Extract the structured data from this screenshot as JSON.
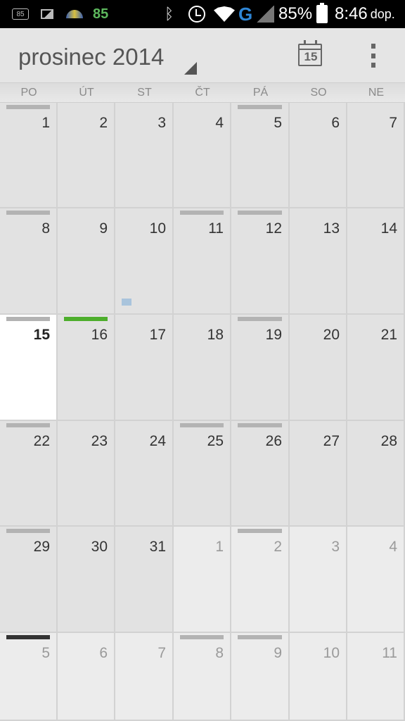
{
  "status_bar": {
    "notification_badge": "85",
    "temperature": "85",
    "network_type": "G",
    "battery": "85%",
    "time": "8:46",
    "time_suffix": "dop.",
    "icons": [
      "notification-85-icon",
      "image-icon",
      "weather-dome-icon",
      "bluetooth-icon",
      "alarm-icon",
      "wifi-icon",
      "cell-signal-icon",
      "battery-icon"
    ]
  },
  "header": {
    "title": "prosinec 2014",
    "today_icon_number": "15",
    "menu_icon": "overflow-menu-icon"
  },
  "weekdays": [
    "PO",
    "ÚT",
    "ST",
    "ČT",
    "PÁ",
    "SO",
    "NE"
  ],
  "colors": {
    "event_bar": "#b3b3b3",
    "event_bar_green": "#4dae2c",
    "event_bar_dark": "#333333",
    "event_block": "#a9c4dc",
    "today_bg": "#ffffff"
  },
  "weeks": [
    [
      {
        "day": "1",
        "bar": "gray"
      },
      {
        "day": "2"
      },
      {
        "day": "3"
      },
      {
        "day": "4"
      },
      {
        "day": "5",
        "bar": "gray"
      },
      {
        "day": "6"
      },
      {
        "day": "7"
      }
    ],
    [
      {
        "day": "8",
        "bar": "gray"
      },
      {
        "day": "9"
      },
      {
        "day": "10",
        "event": true
      },
      {
        "day": "11",
        "bar": "gray"
      },
      {
        "day": "12",
        "bar": "gray"
      },
      {
        "day": "13"
      },
      {
        "day": "14"
      }
    ],
    [
      {
        "day": "15",
        "bar": "gray",
        "today": true
      },
      {
        "day": "16",
        "bar": "green"
      },
      {
        "day": "17"
      },
      {
        "day": "18"
      },
      {
        "day": "19",
        "bar": "gray"
      },
      {
        "day": "20"
      },
      {
        "day": "21"
      }
    ],
    [
      {
        "day": "22",
        "bar": "gray"
      },
      {
        "day": "23"
      },
      {
        "day": "24"
      },
      {
        "day": "25",
        "bar": "gray"
      },
      {
        "day": "26",
        "bar": "gray"
      },
      {
        "day": "27"
      },
      {
        "day": "28"
      }
    ],
    [
      {
        "day": "29",
        "bar": "gray"
      },
      {
        "day": "30"
      },
      {
        "day": "31"
      },
      {
        "day": "1",
        "other": true
      },
      {
        "day": "2",
        "bar": "gray",
        "other": true
      },
      {
        "day": "3",
        "other": true
      },
      {
        "day": "4",
        "other": true
      }
    ],
    [
      {
        "day": "5",
        "bar": "dark",
        "other": true
      },
      {
        "day": "6",
        "other": true
      },
      {
        "day": "7",
        "other": true
      },
      {
        "day": "8",
        "bar": "gray",
        "other": true
      },
      {
        "day": "9",
        "bar": "gray",
        "other": true
      },
      {
        "day": "10",
        "other": true
      },
      {
        "day": "11",
        "other": true
      }
    ]
  ]
}
